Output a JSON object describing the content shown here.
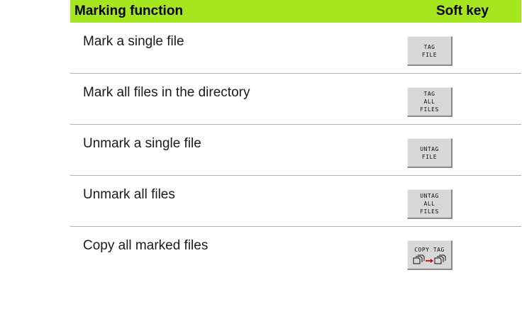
{
  "header": {
    "function_label": "Marking function",
    "softkey_label": "Soft key"
  },
  "rows": [
    {
      "label": "Mark a single file",
      "key_lines": [
        "TAG",
        "FILE"
      ]
    },
    {
      "label": "Mark all files in the directory",
      "key_lines": [
        "TAG",
        "ALL",
        "FILES"
      ]
    },
    {
      "label": "Unmark a single file",
      "key_lines": [
        "UNTAG",
        "FILE"
      ]
    },
    {
      "label": "Unmark all files",
      "key_lines": [
        "UNTAG",
        "ALL",
        "FILES"
      ]
    },
    {
      "label": "Copy all marked files",
      "key_lines": [
        "COPY TAG"
      ],
      "key_icon": "copy-files-icon"
    }
  ],
  "colors": {
    "header_bg": "#a6e61e",
    "softkey_bg": "#d8d8d8",
    "icon_arrow": "#cc0000"
  }
}
